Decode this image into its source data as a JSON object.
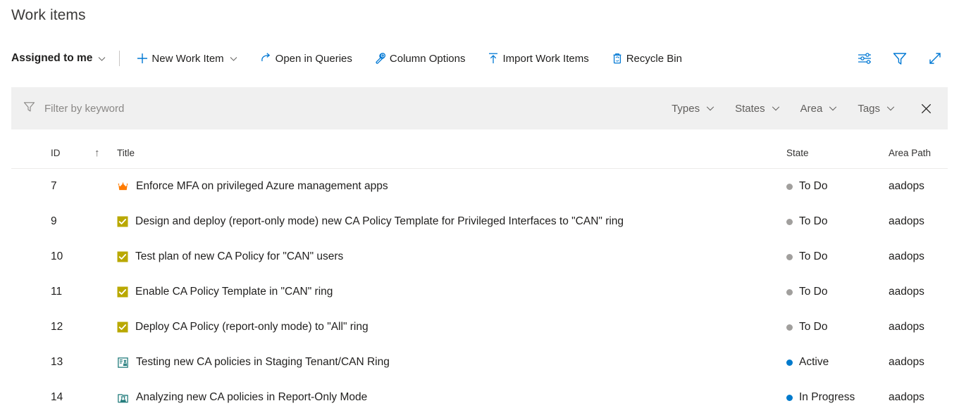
{
  "page": {
    "title": "Work items"
  },
  "toolbar": {
    "query_pivot": "Assigned to me",
    "items": [
      {
        "label": "New Work Item",
        "icon": "plus-icon",
        "has_chevron": true
      },
      {
        "label": "Open in Queries",
        "icon": "open-in-queries-icon",
        "has_chevron": false
      },
      {
        "label": "Column Options",
        "icon": "column-options-wrench-icon",
        "has_chevron": false
      },
      {
        "label": "Import Work Items",
        "icon": "import-arrow-up-icon",
        "has_chevron": false
      },
      {
        "label": "Recycle Bin",
        "icon": "recycle-bin-icon",
        "has_chevron": false
      }
    ],
    "right_icons": [
      {
        "name": "view-options-sliders-icon"
      },
      {
        "name": "filter-funnel-icon"
      },
      {
        "name": "fullscreen-expand-icon"
      }
    ]
  },
  "filter_bar": {
    "placeholder": "Filter by keyword",
    "value": "",
    "pills": [
      {
        "label": "Types"
      },
      {
        "label": "States"
      },
      {
        "label": "Area"
      },
      {
        "label": "Tags"
      }
    ],
    "close_label": "✕"
  },
  "grid": {
    "columns": {
      "id": "ID",
      "sort_indicator": "↑",
      "title": "Title",
      "state": "State",
      "area_path": "Area Path"
    },
    "rows": [
      {
        "id": "7",
        "type_icon": "epic-crown-icon",
        "title": "Enforce MFA on privileged Azure management apps",
        "state": "To Do",
        "state_color": "#a19f9d",
        "area_path": "aadops"
      },
      {
        "id": "9",
        "type_icon": "task-checkbox-icon",
        "title": "Design and deploy (report-only mode) new CA Policy Template for Privileged Interfaces to \"CAN\" ring",
        "state": "To Do",
        "state_color": "#a19f9d",
        "area_path": "aadops"
      },
      {
        "id": "10",
        "type_icon": "task-checkbox-icon",
        "title": "Test plan of new CA Policy for \"CAN\" users",
        "state": "To Do",
        "state_color": "#a19f9d",
        "area_path": "aadops"
      },
      {
        "id": "11",
        "type_icon": "task-checkbox-icon",
        "title": "Enable CA Policy Template in \"CAN\" ring",
        "state": "To Do",
        "state_color": "#a19f9d",
        "area_path": "aadops"
      },
      {
        "id": "12",
        "type_icon": "task-checkbox-icon",
        "title": "Deploy CA Policy (report-only mode) to \"All\" ring",
        "state": "To Do",
        "state_color": "#a19f9d",
        "area_path": "aadops"
      },
      {
        "id": "13",
        "type_icon": "test-plan-icon",
        "title": "Testing new CA policies in Staging Tenant/CAN Ring",
        "state": "Active",
        "state_color": "#007acc",
        "area_path": "aadops"
      },
      {
        "id": "14",
        "type_icon": "test-suite-icon",
        "title": "Analyzing new CA policies in Report-Only Mode",
        "state": "In Progress",
        "state_color": "#007acc",
        "area_path": "aadops"
      }
    ]
  },
  "colors": {
    "accent": "#0078d4",
    "epic": "#ff7b00",
    "task": "#b9a800",
    "test": "#1f7a7a",
    "filter_bar_bg": "#f0f0f0"
  }
}
